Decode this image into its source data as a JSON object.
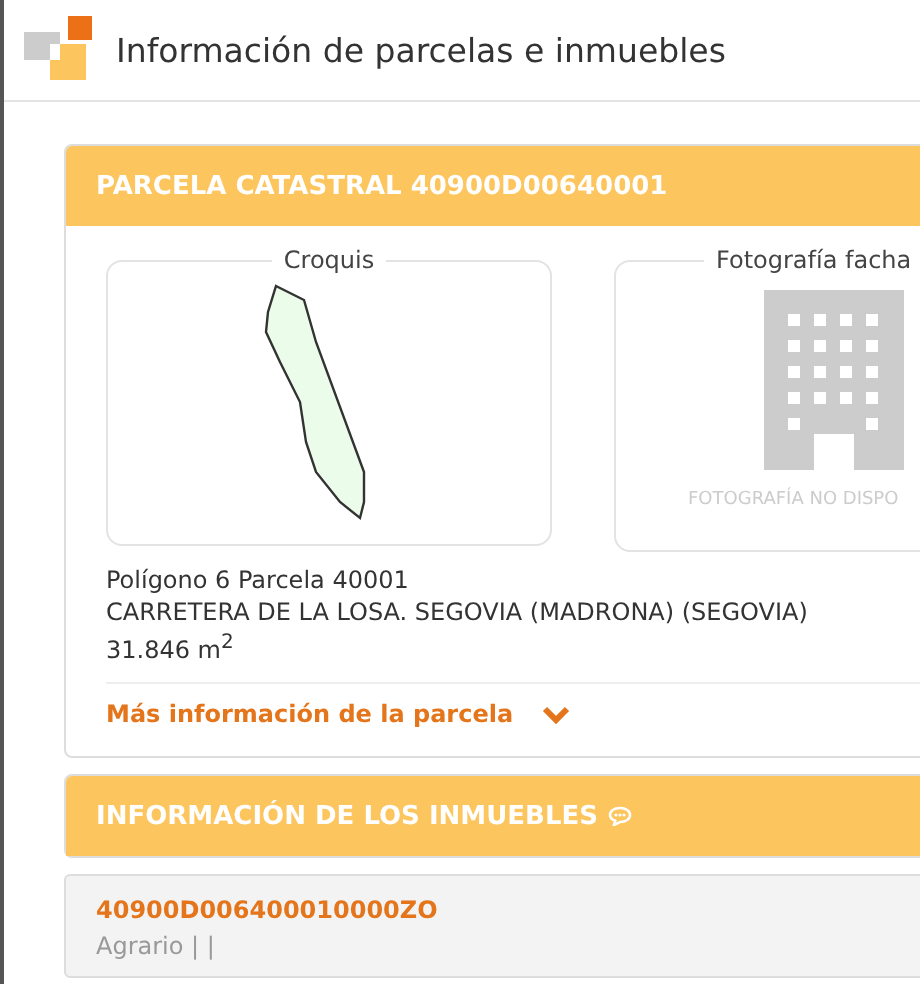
{
  "title": "Información de parcelas e inmuebles",
  "parcel": {
    "header": "PARCELA CATASTRAL 40900D00640001",
    "sketch_label": "Croquis",
    "photo_label": "Fotografía facha",
    "photo_placeholder": "FOTOGRAFÍA NO DISPO",
    "lines": [
      "Polígono 6 Parcela 40001",
      "CARRETERA DE LA LOSA. SEGOVIA (MADRONA) (SEGOVIA)",
      "31.846 m$^{2}$"
    ],
    "more_link": {
      "label": "Más información de la parcela",
      "expanded": false
    }
  },
  "properties": {
    "header": "INFORMACIÓN DE LOS INMUEBLES",
    "items": [
      {
        "reference": "40900D006400010000ZO",
        "use": "Agrario | |"
      }
    ]
  }
}
